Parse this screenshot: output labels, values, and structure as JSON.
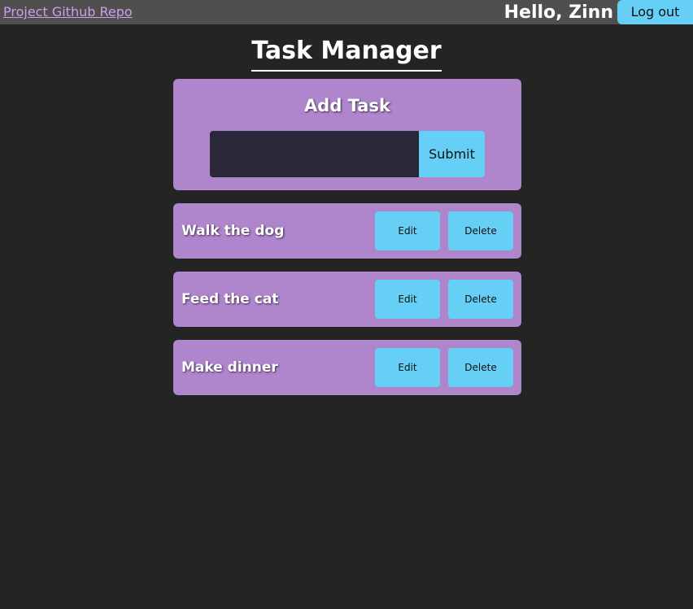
{
  "header": {
    "repo_link": "Project Github Repo",
    "greeting": "Hello, Zinn",
    "logout_label": "Log out"
  },
  "page": {
    "title": "Task Manager"
  },
  "add_task": {
    "title": "Add Task",
    "input_value": "",
    "submit_label": "Submit"
  },
  "tasks": [
    {
      "label": "Walk the dog",
      "edit_label": "Edit",
      "delete_label": "Delete"
    },
    {
      "label": "Feed the cat",
      "edit_label": "Edit",
      "delete_label": "Delete"
    },
    {
      "label": "Make dinner",
      "edit_label": "Edit",
      "delete_label": "Delete"
    }
  ],
  "colors": {
    "background": "#242424",
    "topbar": "#4f4f4f",
    "card": "#af85cc",
    "accent_button": "#66cff5",
    "input_background": "#2a2838",
    "link": "#cf9de8"
  }
}
